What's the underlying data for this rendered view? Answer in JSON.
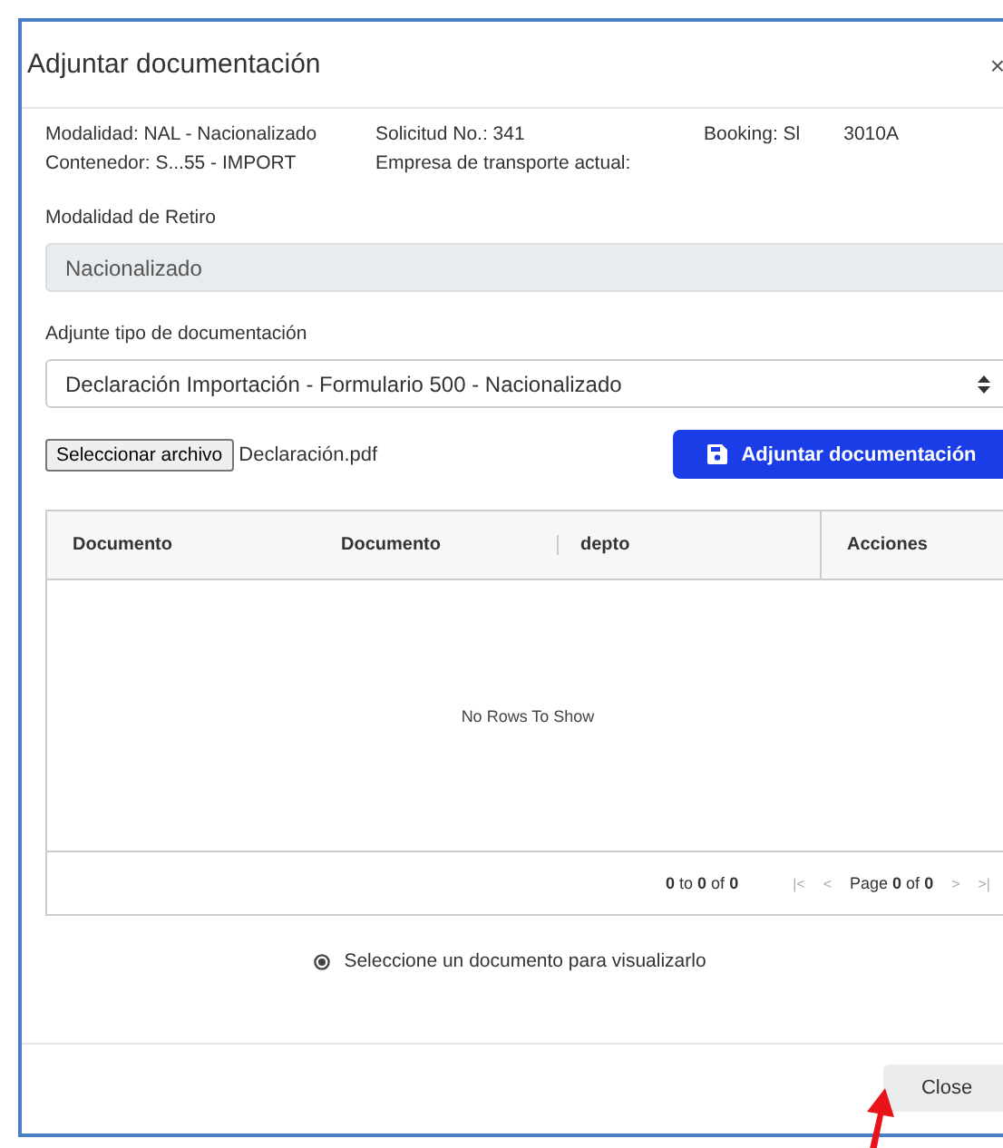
{
  "dialog": {
    "title": "Adjuntar documentación",
    "close_symbol": "×"
  },
  "info": [
    {
      "kind": "text",
      "text": "Modalidad: NAL - Nacionalizado"
    },
    {
      "kind": "text",
      "text": "Solicitud No.: 341"
    },
    {
      "kind": "split",
      "parts": [
        "Booking: Sl",
        "3010A"
      ]
    },
    {
      "kind": "text",
      "text": "Contenedor: S...55 - IMPORT"
    },
    {
      "kind": "text",
      "text": "Empresa de transporte actual:"
    }
  ],
  "retiro": {
    "label": "Modalidad de Retiro",
    "value": "Nacionalizado",
    "disabled": true
  },
  "tipo": {
    "label": "Adjunte tipo de documentación",
    "value": "Declaración Importación - Formulario 500 - Nacionalizado"
  },
  "file": {
    "button": "Seleccionar archivo",
    "filename": "Declaración.pdf"
  },
  "attach_button": "Adjuntar documentación",
  "table": {
    "columns": [
      "Documento",
      "Documento",
      "depto",
      "Acciones"
    ],
    "empty": "No Rows To Show",
    "pagination": {
      "range": "**0** to **0** of **0**",
      "page": "Page **0** of **0**",
      "first": "|<",
      "prev": "<",
      "next": ">",
      "last": ">|"
    }
  },
  "hint": "Seleccione un documento para visualizarlo",
  "footer": {
    "button": "Close"
  }
}
